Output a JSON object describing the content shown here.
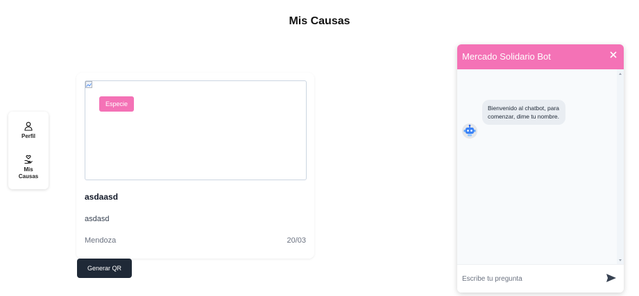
{
  "page": {
    "title": "Mis Causas"
  },
  "sidebar": {
    "items": [
      {
        "label": "Perfil",
        "icon": "user-icon"
      },
      {
        "label_line1": "Mis",
        "label_line2": "Causas",
        "icon": "hand-heart-icon"
      }
    ]
  },
  "cause_card": {
    "badge": "Especie",
    "title": "asdaasd",
    "description": "asdasd",
    "location": "Mendoza",
    "date": "20/03",
    "badge_color": "#f472b6"
  },
  "actions": {
    "generate_qr_label": "Generar QR"
  },
  "chatbot": {
    "title": "Mercado Solidario Bot",
    "messages": [
      {
        "from": "bot",
        "text": "Bienvenido al chatbot, para comenzar, dime tu nombre."
      }
    ],
    "input_placeholder": "Escribe tu pregunta",
    "header_color": "#f472b6"
  },
  "colors": {
    "accent_pink": "#f472b6",
    "button_dark": "#1f2937"
  }
}
